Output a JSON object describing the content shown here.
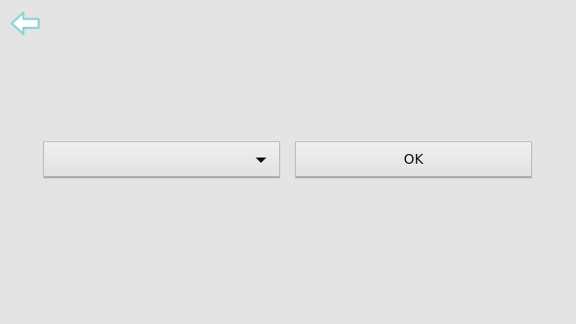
{
  "header": {
    "back_icon": "back-arrow-icon",
    "back_icon_color": "#8fd4d6"
  },
  "form": {
    "dropdown": {
      "selected_value": "",
      "arrow_icon": "caret-down-icon"
    },
    "ok_label": "OK"
  },
  "colors": {
    "background": "#e4e4e4",
    "button_face": "#e8e8e8"
  }
}
